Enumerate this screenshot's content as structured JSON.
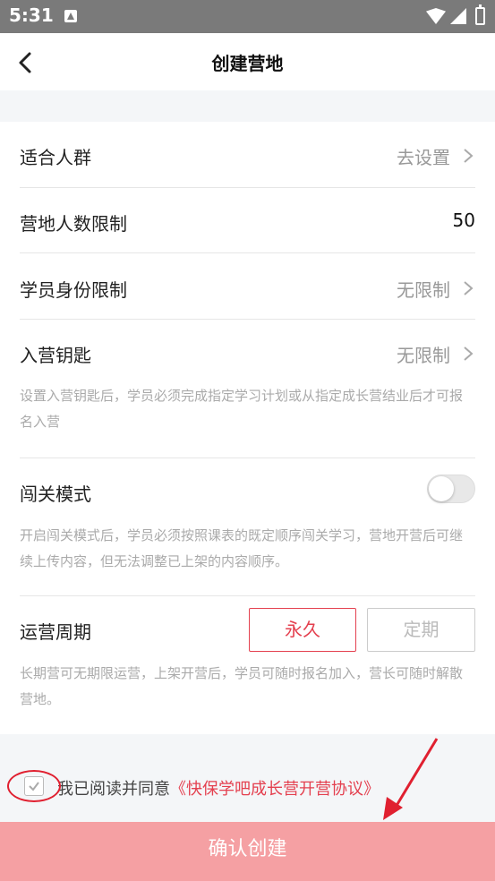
{
  "status_bar": {
    "time": "5:31"
  },
  "header": {
    "title": "创建营地"
  },
  "rows": {
    "audience": {
      "label": "适合人群",
      "value": "去设置"
    },
    "capacity": {
      "label": "营地人数限制",
      "value": "50"
    },
    "identity": {
      "label": "学员身份限制",
      "value": "无限制"
    },
    "key": {
      "label": "入营钥匙",
      "value": "无限制",
      "hint": "设置入营钥匙后，学员必须完成指定学习计划或从指定成长营结业后才可报名入营"
    },
    "challenge": {
      "label": "闯关模式",
      "enabled": false,
      "hint": "开启闯关模式后，学员必须按照课表的既定顺序闯关学习，营地开营后可继续上传内容，但无法调整已上架的内容顺序。"
    },
    "cycle": {
      "label": "运营周期",
      "options": [
        "永久",
        "定期"
      ],
      "selected": "永久",
      "hint": "长期营可无期限运营，上架开营后，学员可随时报名加入，营长可随时解散营地。"
    }
  },
  "agreement": {
    "checked": true,
    "prefix": "我已阅读并同意",
    "link": "《快保学吧成长营开营协议》"
  },
  "footer": {
    "confirm_label": "确认创建"
  },
  "colors": {
    "accent": "#e4404f",
    "confirm_bg": "#f5a0a3",
    "page_gap": "#f4f6f8",
    "status_bar": "#7a7a7a"
  }
}
